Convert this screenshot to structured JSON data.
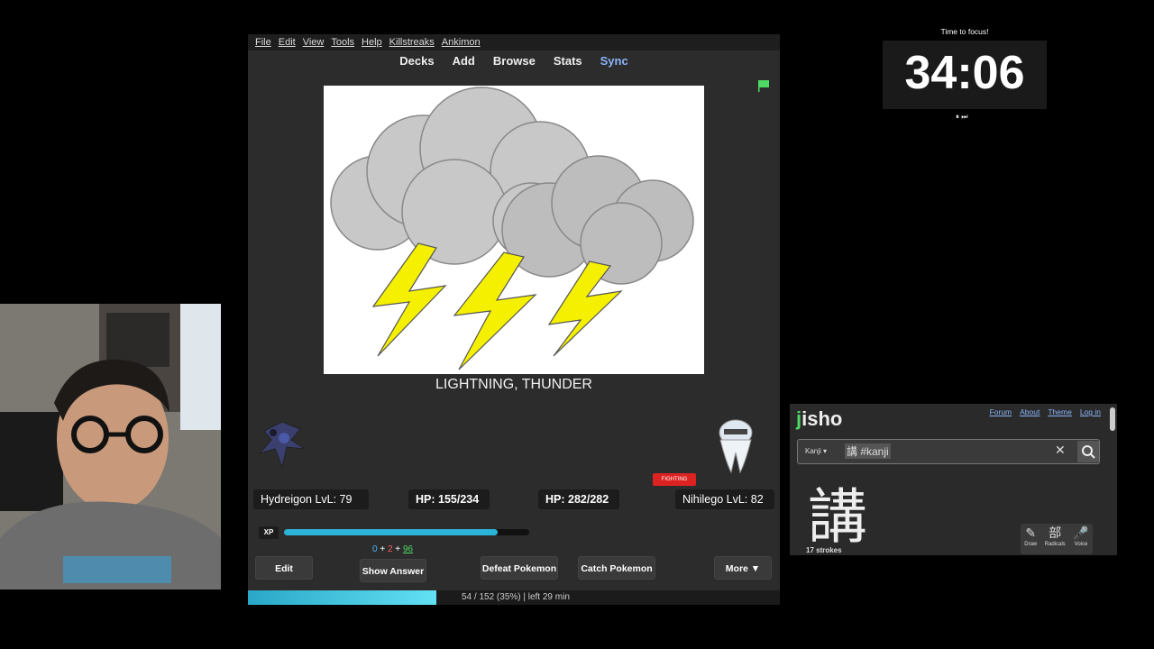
{
  "anki": {
    "menu": [
      "File",
      "Edit",
      "View",
      "Tools",
      "Help",
      "Killstreaks",
      "Ankimon"
    ],
    "toolbar": {
      "decks": "Decks",
      "add": "Add",
      "browse": "Browse",
      "stats": "Stats",
      "sync": "Sync"
    },
    "card": {
      "text": "LIGHTNING, THUNDER"
    },
    "battle": {
      "player_name": "Hydreigon LvL: 79",
      "player_hp": "HP: 155/234",
      "enemy_hp": "HP: 282/282",
      "enemy_name": "Nihilego LvL: 82",
      "type_badge": "FIGHTING",
      "xp_label": "XP",
      "xp_progress": 0.87,
      "xp_gain": {
        "a": "0",
        "plus1": " + ",
        "b": "2",
        "plus2": " + ",
        "c": "96"
      }
    },
    "buttons": {
      "edit": "Edit",
      "show_answer": "Show Answer",
      "defeat": "Defeat Pokemon",
      "catch": "Catch Pokemon",
      "more": "More ▼"
    },
    "progress": {
      "text": "54 / 152 (35%) | left 29 min",
      "fraction": 0.355
    },
    "colors": {
      "flag": "#4cd964",
      "xp": "#2bb3d8",
      "sync": "#8ab4f8"
    }
  },
  "timer": {
    "label": "Time to focus!",
    "value": "34:06",
    "controls": "⏸ ⏭"
  },
  "jisho": {
    "logo_j": "j",
    "logo_rest": "isho",
    "nav": [
      "Forum",
      "About",
      "Theme",
      "Log in"
    ],
    "search_mode": "Kanji ▾",
    "query": "講 #kanji",
    "clear": "✕",
    "kanji": "講",
    "strokes": "17 strokes",
    "tools": [
      {
        "icon": "draw-icon",
        "glyph": "✎",
        "label": "Draw"
      },
      {
        "icon": "radicals-icon",
        "glyph": "部",
        "label": "Radicals"
      },
      {
        "icon": "voice-icon",
        "glyph": "🎤",
        "label": "Voice"
      }
    ]
  }
}
